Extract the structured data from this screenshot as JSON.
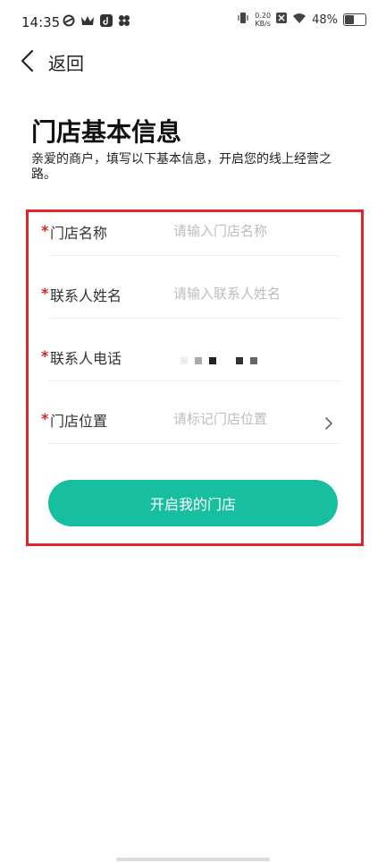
{
  "status_bar": {
    "time": "14:35",
    "net_speed_value": "0.20",
    "net_speed_unit": "KB/s",
    "battery_percent": "48%",
    "battery_level": 0.48,
    "left_icons": [
      "sync-icon",
      "crown-icon",
      "tiktok-icon",
      "petal-icon"
    ],
    "right_icons": [
      "vibrate-icon",
      "sim-off-icon",
      "wifi-icon",
      "battery-icon"
    ]
  },
  "nav": {
    "back_label": "返回"
  },
  "page": {
    "title": "门店基本信息",
    "subtitle": "亲爱的商户，填写以下基本信息，开启您的线上经营之路。"
  },
  "form": {
    "required_mark": "*",
    "fields": [
      {
        "label": "门店名称",
        "placeholder": "请输入门店名称"
      },
      {
        "label": "联系人姓名",
        "placeholder": "请输入联系人姓名"
      },
      {
        "label": "联系人电话",
        "value_masked": true
      },
      {
        "label": "门店位置",
        "placeholder": "请标记门店位置"
      }
    ],
    "submit_label": "开启我的门店"
  },
  "colors": {
    "accent": "#18bea0",
    "highlight_border": "#e0242e",
    "required": "#d6231f",
    "placeholder": "#bdbdbd"
  }
}
